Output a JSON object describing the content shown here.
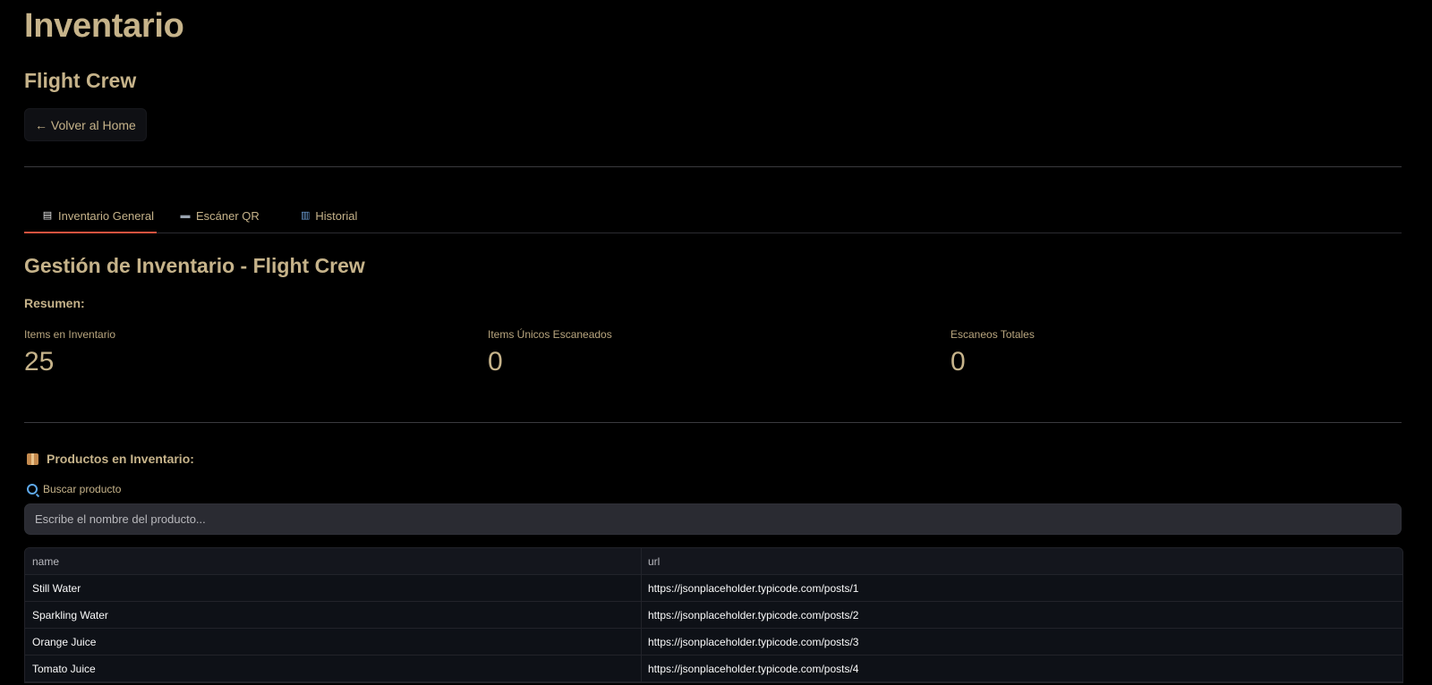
{
  "page": {
    "title": "Inventario",
    "subtitle": "Flight Crew",
    "back_button": "← Volver al Home"
  },
  "tabs": [
    {
      "label": "Inventario General",
      "icon": "clipboard-icon",
      "active": true
    },
    {
      "label": "Escáner QR",
      "icon": "keyboard-icon",
      "active": false
    },
    {
      "label": "Historial",
      "icon": "bar-chart-icon",
      "active": false
    }
  ],
  "main": {
    "section_title": "Gestión de Inventario - Flight Crew",
    "resumen_label": "Resumen:",
    "metrics": [
      {
        "label": "Items en Inventario",
        "value": "25"
      },
      {
        "label": "Items Únicos Escaneados",
        "value": "0"
      },
      {
        "label": "Escaneos Totales",
        "value": "0"
      }
    ],
    "products_title": "Productos en Inventario:",
    "search_label": "Buscar producto",
    "search_placeholder": "Escribe el nombre del producto..."
  },
  "table": {
    "columns": [
      "name",
      "url"
    ],
    "rows": [
      {
        "name": "Still Water",
        "url": "https://jsonplaceholder.typicode.com/posts/1"
      },
      {
        "name": "Sparkling Water",
        "url": "https://jsonplaceholder.typicode.com/posts/2"
      },
      {
        "name": "Orange Juice",
        "url": "https://jsonplaceholder.typicode.com/posts/3"
      },
      {
        "name": "Tomato Juice",
        "url": "https://jsonplaceholder.typicode.com/posts/4"
      }
    ]
  },
  "colors": {
    "background": "#000000",
    "accent_text": "#c6b38a",
    "active_tab_underline": "#e0533f",
    "input_bg": "#2a2b32",
    "table_bg": "#0e1117"
  }
}
